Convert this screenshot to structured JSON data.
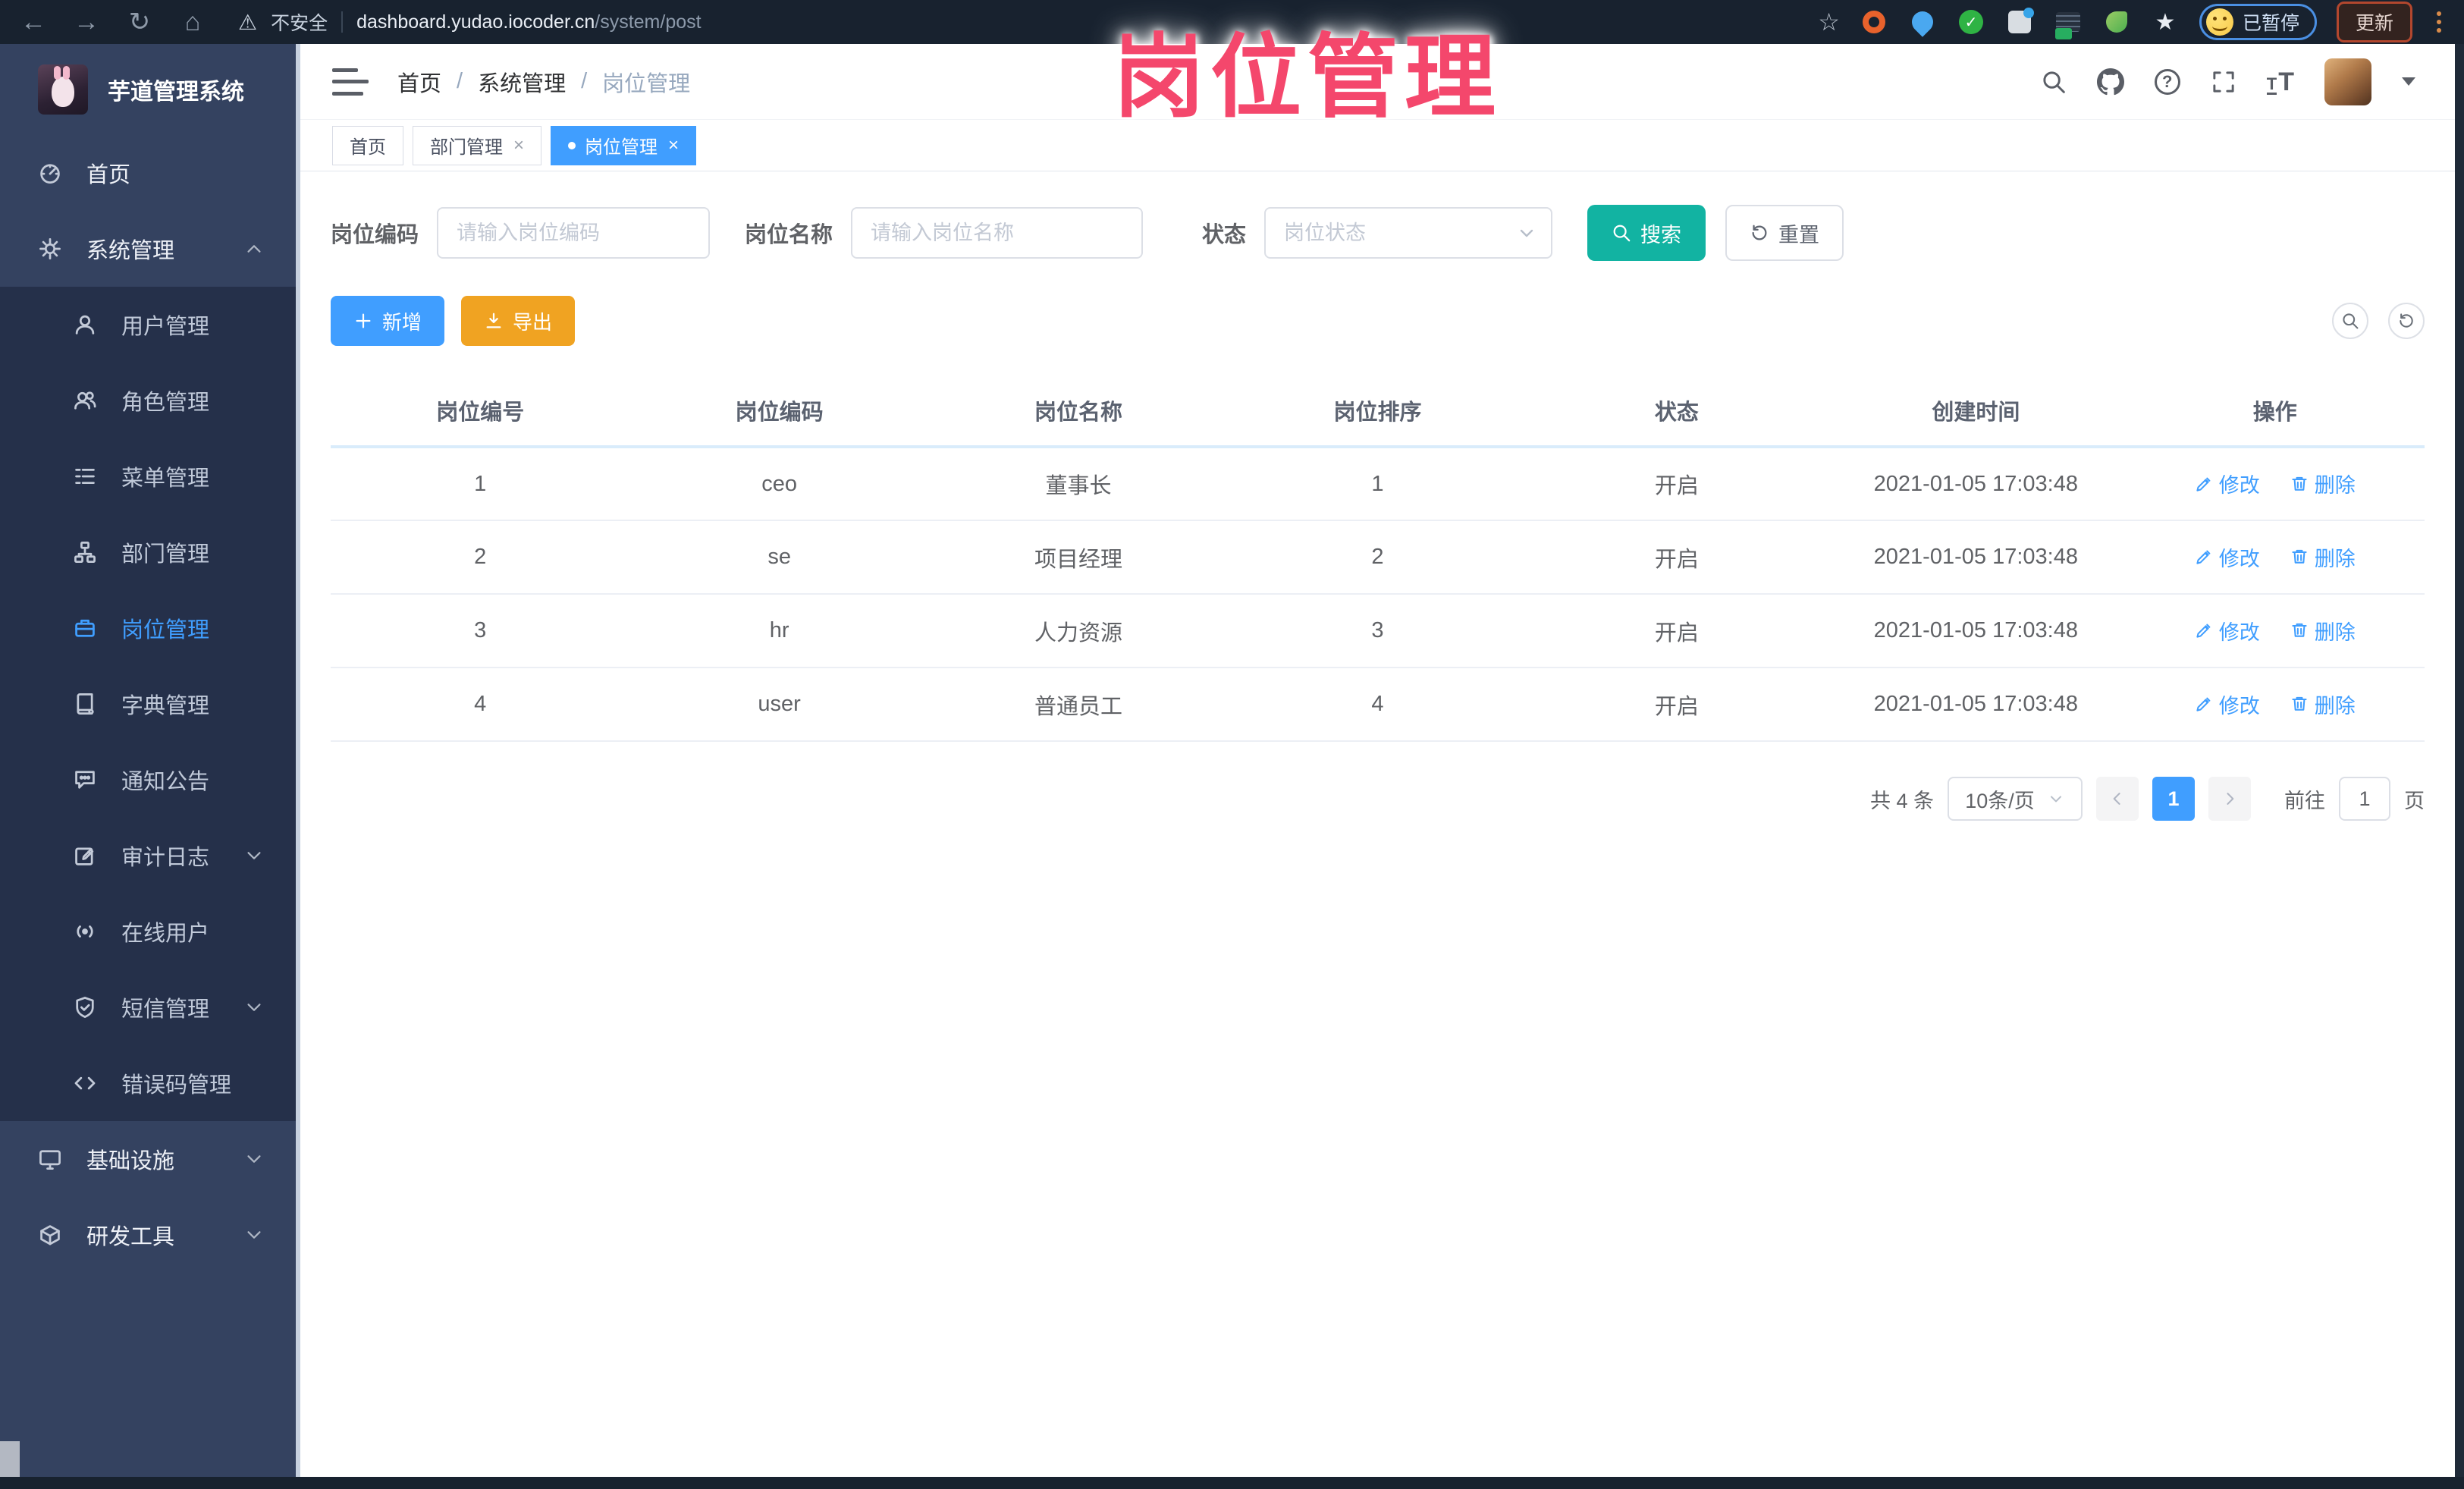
{
  "browser": {
    "security_label": "不安全",
    "url_domain": "dashboard.yudao.iocoder.cn",
    "url_path": "/system/post",
    "paused_label": "已暂停",
    "update_label": "更新"
  },
  "overlay_title": "岗位管理",
  "sidebar": {
    "app_title": "芋道管理系统",
    "items": [
      {
        "label": "首页",
        "icon": "gauge-icon"
      },
      {
        "label": "系统管理",
        "icon": "gear-icon",
        "chevron": "up",
        "expanded": true
      },
      {
        "label": "用户管理",
        "icon": "user-icon"
      },
      {
        "label": "角色管理",
        "icon": "users-icon"
      },
      {
        "label": "菜单管理",
        "icon": "menu-list-icon"
      },
      {
        "label": "部门管理",
        "icon": "org-tree-icon"
      },
      {
        "label": "岗位管理",
        "icon": "briefcase-icon",
        "active": true
      },
      {
        "label": "字典管理",
        "icon": "dictionary-icon"
      },
      {
        "label": "通知公告",
        "icon": "announcement-icon"
      },
      {
        "label": "审计日志",
        "icon": "audit-log-icon",
        "chevron": "down"
      },
      {
        "label": "在线用户",
        "icon": "online-users-icon"
      },
      {
        "label": "短信管理",
        "icon": "sms-shield-icon",
        "chevron": "down"
      },
      {
        "label": "错误码管理",
        "icon": "error-code-icon"
      },
      {
        "label": "基础设施",
        "icon": "infrastructure-icon",
        "chevron": "down"
      },
      {
        "label": "研发工具",
        "icon": "devtools-icon",
        "chevron": "down"
      }
    ]
  },
  "navbar": {
    "breadcrumb": [
      "首页",
      "系统管理",
      "岗位管理"
    ]
  },
  "tabs": [
    {
      "label": "首页",
      "closable": false,
      "active": false
    },
    {
      "label": "部门管理",
      "closable": true,
      "active": false
    },
    {
      "label": "岗位管理",
      "closable": true,
      "active": true
    }
  ],
  "filters": {
    "post_code_label": "岗位编码",
    "post_code_placeholder": "请输入岗位编码",
    "post_name_label": "岗位名称",
    "post_name_placeholder": "请输入岗位名称",
    "status_label": "状态",
    "status_placeholder": "岗位状态",
    "search_label": "搜索",
    "reset_label": "重置"
  },
  "toolbar": {
    "add_label": "新增",
    "export_label": "导出"
  },
  "table": {
    "columns": [
      "岗位编号",
      "岗位编码",
      "岗位名称",
      "岗位排序",
      "状态",
      "创建时间",
      "操作"
    ],
    "rows": [
      {
        "id": "1",
        "code": "ceo",
        "name": "董事长",
        "sort": "1",
        "status": "开启",
        "created": "2021-01-05 17:03:48"
      },
      {
        "id": "2",
        "code": "se",
        "name": "项目经理",
        "sort": "2",
        "status": "开启",
        "created": "2021-01-05 17:03:48"
      },
      {
        "id": "3",
        "code": "hr",
        "name": "人力资源",
        "sort": "3",
        "status": "开启",
        "created": "2021-01-05 17:03:48"
      },
      {
        "id": "4",
        "code": "user",
        "name": "普通员工",
        "sort": "4",
        "status": "开启",
        "created": "2021-01-05 17:03:48"
      }
    ],
    "edit_label": "修改",
    "delete_label": "删除"
  },
  "pagination": {
    "total_label": "共 4 条",
    "page_size_label": "10条/页",
    "current_page": "1",
    "goto_label": "前往",
    "goto_value": "1",
    "page_unit_label": "页"
  },
  "colors": {
    "primary_blue": "#409EFF",
    "search_teal": "#12b3a2",
    "export_orange": "#f0a322",
    "overlay_pink": "#f4476c",
    "sidebar_bg": "#344260",
    "browser_bar_bg": "#18222f"
  }
}
